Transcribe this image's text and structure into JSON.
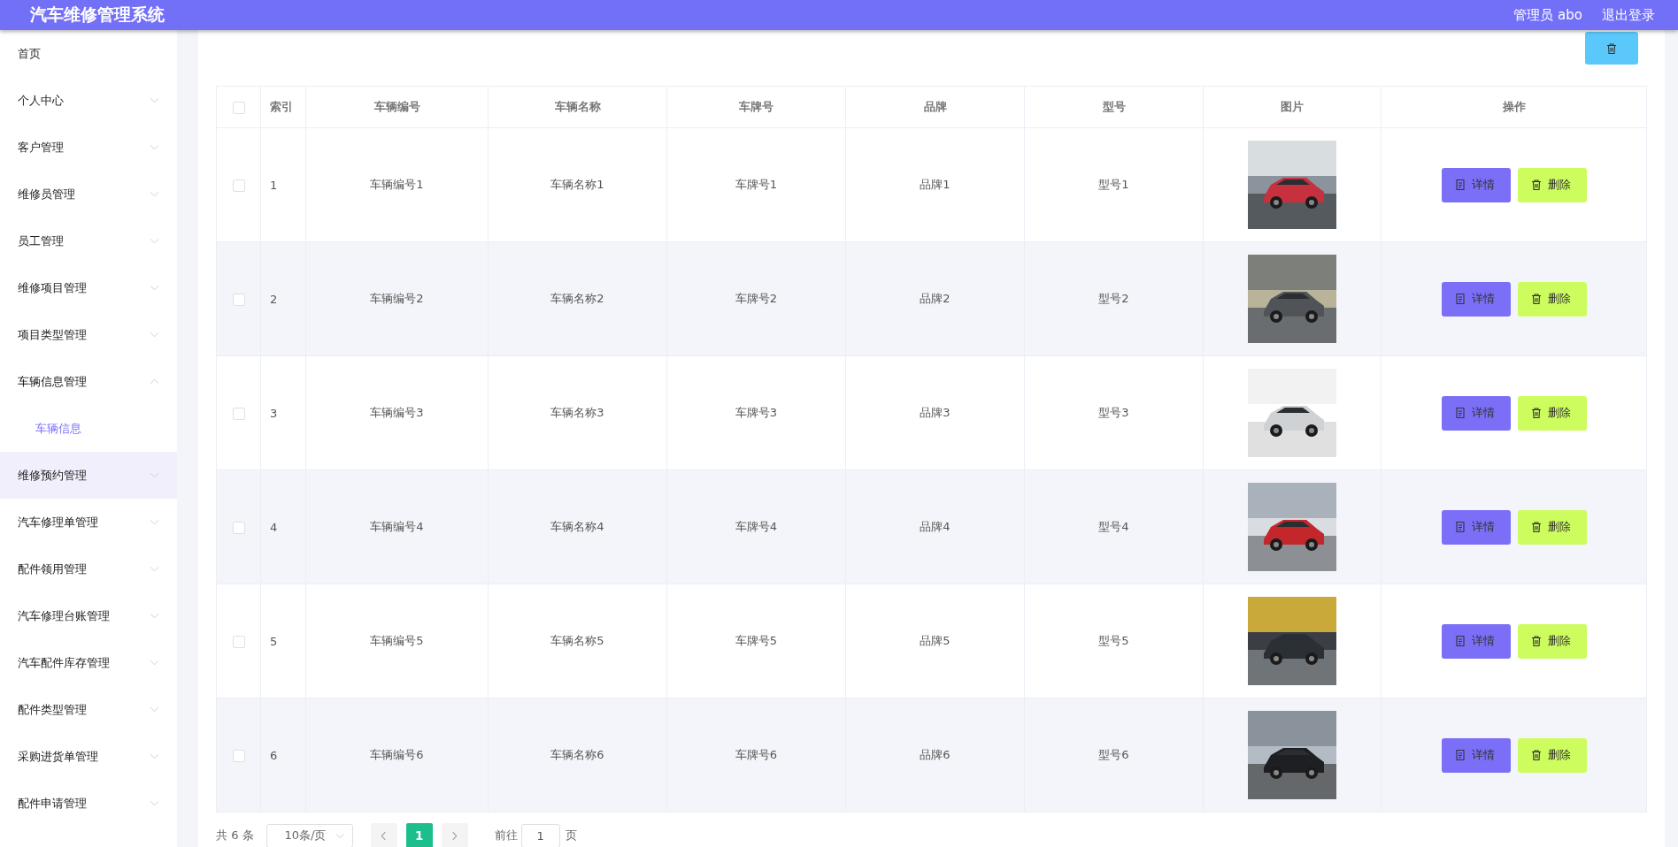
{
  "header": {
    "title": "汽车维修管理系统",
    "user": "管理员 abo",
    "logout": "退出登录"
  },
  "sidebar": {
    "items": [
      {
        "label": "首页",
        "expandable": false,
        "expanded": false,
        "hovered": false
      },
      {
        "label": "个人中心",
        "expandable": true,
        "expanded": false,
        "hovered": false
      },
      {
        "label": "客户管理",
        "expandable": true,
        "expanded": false,
        "hovered": false
      },
      {
        "label": "维修员管理",
        "expandable": true,
        "expanded": false,
        "hovered": false
      },
      {
        "label": "员工管理",
        "expandable": true,
        "expanded": false,
        "hovered": false
      },
      {
        "label": "维修项目管理",
        "expandable": true,
        "expanded": false,
        "hovered": false
      },
      {
        "label": "项目类型管理",
        "expandable": true,
        "expanded": false,
        "hovered": false
      },
      {
        "label": "车辆信息管理",
        "expandable": true,
        "expanded": true,
        "hovered": false,
        "children": [
          {
            "label": "车辆信息",
            "selected": true
          }
        ]
      },
      {
        "label": "维修预约管理",
        "expandable": true,
        "expanded": false,
        "hovered": true
      },
      {
        "label": "汽车修理单管理",
        "expandable": true,
        "expanded": false,
        "hovered": false
      },
      {
        "label": "配件领用管理",
        "expandable": true,
        "expanded": false,
        "hovered": false
      },
      {
        "label": "汽车修理台账管理",
        "expandable": true,
        "expanded": false,
        "hovered": false
      },
      {
        "label": "汽车配件库存管理",
        "expandable": true,
        "expanded": false,
        "hovered": false
      },
      {
        "label": "配件类型管理",
        "expandable": true,
        "expanded": false,
        "hovered": false
      },
      {
        "label": "采购进货单管理",
        "expandable": true,
        "expanded": false,
        "hovered": false
      },
      {
        "label": "配件申请管理",
        "expandable": true,
        "expanded": false,
        "hovered": false
      }
    ]
  },
  "table": {
    "select_all_checked": false,
    "columns": [
      "索引",
      "车辆编号",
      "车辆名称",
      "车牌号",
      "品牌",
      "型号",
      "图片",
      "操作"
    ],
    "rows": [
      {
        "checked": false,
        "cells": [
          "1",
          "车辆编号1",
          "车辆名称1",
          "车牌号1",
          "品牌1",
          "型号1"
        ],
        "actions": [
          {
            "kind": "detail",
            "label": "详情"
          },
          {
            "kind": "delete",
            "label": "删除"
          }
        ]
      },
      {
        "checked": false,
        "cells": [
          "2",
          "车辆编号2",
          "车辆名称2",
          "车牌号2",
          "品牌2",
          "型号2"
        ],
        "actions": [
          {
            "kind": "detail",
            "label": "详情"
          },
          {
            "kind": "delete",
            "label": "删除"
          }
        ]
      },
      {
        "checked": false,
        "cells": [
          "3",
          "车辆编号3",
          "车辆名称3",
          "车牌号3",
          "品牌3",
          "型号3"
        ],
        "actions": [
          {
            "kind": "detail",
            "label": "详情"
          },
          {
            "kind": "delete",
            "label": "删除"
          }
        ]
      },
      {
        "checked": false,
        "cells": [
          "4",
          "车辆编号4",
          "车辆名称4",
          "车牌号4",
          "品牌4",
          "型号4"
        ],
        "actions": [
          {
            "kind": "detail",
            "label": "详情"
          },
          {
            "kind": "delete",
            "label": "删除"
          }
        ]
      },
      {
        "checked": false,
        "cells": [
          "5",
          "车辆编号5",
          "车辆名称5",
          "车牌号5",
          "品牌5",
          "型号5"
        ],
        "actions": [
          {
            "kind": "detail",
            "label": "详情"
          },
          {
            "kind": "delete",
            "label": "删除"
          }
        ]
      },
      {
        "checked": false,
        "cells": [
          "6",
          "车辆编号6",
          "车辆名称6",
          "车牌号6",
          "品牌6",
          "型号6"
        ],
        "actions": [
          {
            "kind": "detail",
            "label": "详情"
          },
          {
            "kind": "delete",
            "label": "删除"
          }
        ]
      }
    ]
  },
  "pagination": {
    "total": "共 6 条",
    "page_size": "10条/页",
    "pages": [
      {
        "label": "1",
        "selected": true
      }
    ],
    "goto_label": "前往",
    "goto_value": "1",
    "page_suffix": "页"
  }
}
